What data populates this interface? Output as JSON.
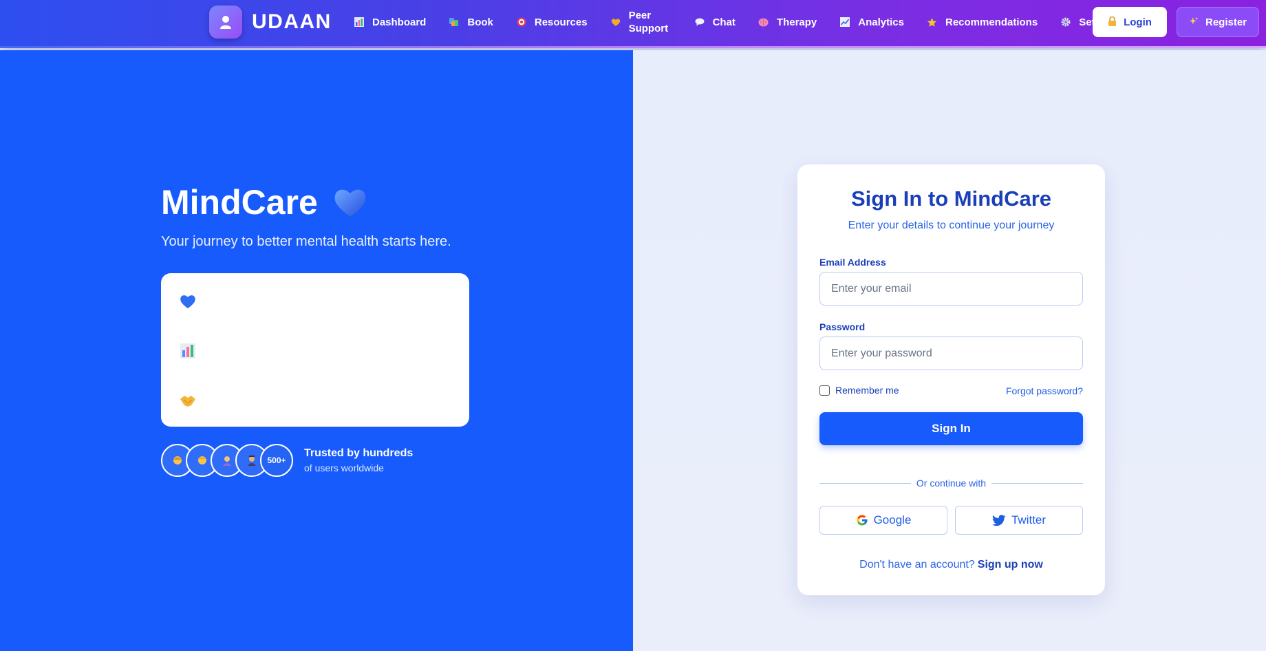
{
  "nav": {
    "brand": "UDAAN",
    "brand_icon": "person-icon",
    "items": [
      {
        "label": "Dashboard",
        "icon": "bar-chart-icon"
      },
      {
        "label": "Book",
        "icon": "books-icon"
      },
      {
        "label": "Resources",
        "icon": "target-icon"
      },
      {
        "label": "Peer Support",
        "icon": "heart-icon"
      },
      {
        "label": "Chat",
        "icon": "speech-bubble-icon"
      },
      {
        "label": "Therapy",
        "icon": "brain-icon"
      },
      {
        "label": "Analytics",
        "icon": "trend-chart-icon"
      },
      {
        "label": "Recommendations",
        "icon": "star-icon"
      },
      {
        "label": "Settings",
        "icon": "gear-icon"
      }
    ],
    "login_label": "Login",
    "register_label": "Register"
  },
  "hero": {
    "title": "MindCare",
    "subtitle": "Your journey to better mental health starts here.",
    "features": [
      {
        "icon": "blue-heart-icon",
        "label": ""
      },
      {
        "icon": "bar-chart-icon",
        "label": ""
      },
      {
        "icon": "handshake-icon",
        "label": ""
      }
    ],
    "trust": {
      "count_badge": "500+",
      "title": "Trusted by hundreds",
      "subtitle": "of users worldwide"
    }
  },
  "login": {
    "title": "Sign In to MindCare",
    "subtitle": "Enter your details to continue your journey",
    "email_label": "Email Address",
    "email_placeholder": "Enter your email",
    "email_value": "",
    "password_label": "Password",
    "password_placeholder": "Enter your password",
    "password_value": "",
    "remember_label": "Remember me",
    "remember_checked": false,
    "forgot_label": "Forgot password?",
    "signin_label": "Sign In",
    "divider_label": "Or continue with",
    "google_label": "Google",
    "twitter_label": "Twitter",
    "signup_prompt": "Don't have an account?",
    "signup_link": "Sign up now"
  },
  "colors": {
    "primary": "#175bfd",
    "heading": "#1a3fb8",
    "nav_gradient_start": "#2e4ff0",
    "nav_gradient_end": "#8a22e0"
  }
}
